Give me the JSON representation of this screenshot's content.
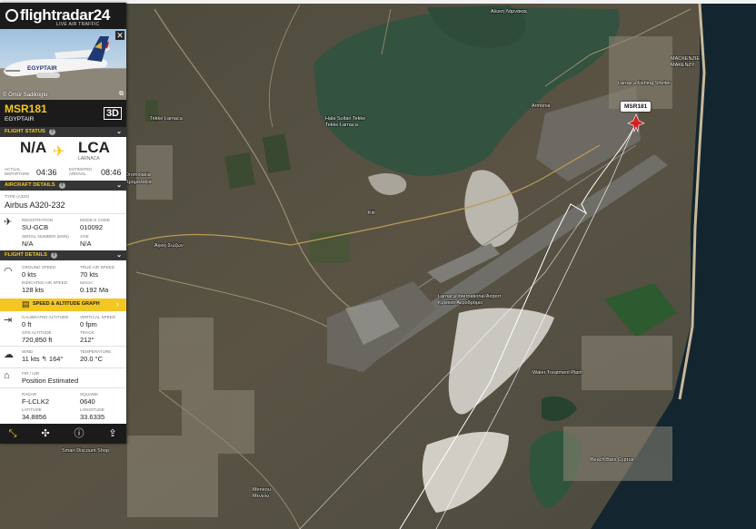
{
  "app": {
    "logo": "flightradar24",
    "tagline": "LIVE AIR TRAFFIC"
  },
  "photo": {
    "credit": "© Ömür Sadikoglu",
    "livery": "EGYPTAIR"
  },
  "flight": {
    "callsign": "MSR181",
    "airline": "EGYPTAIR",
    "view3d": "3D"
  },
  "sections": {
    "status": "FLIGHT STATUS",
    "aircraft": "AIRCRAFT DETAILS",
    "details": "FLIGHT DETAILS"
  },
  "route": {
    "origin": "N/A",
    "destination": "LCA",
    "destination_city": "LARNACA",
    "actual_departure_label": "ACTUAL\nDEPARTURE",
    "actual_departure": "04:36",
    "estimated_arrival_label": "ESTIMATED\nARRIVAL",
    "estimated_arrival": "08:46"
  },
  "aircraft": {
    "type_label": "TYPE",
    "type_code": "(A320)",
    "type": "Airbus A320-232",
    "registration_label": "REGISTRATION",
    "registration": "SU-GCB",
    "modes_label": "MODE-S CODE",
    "modes": "010092",
    "serial_label": "SERIAL NUMBER (MSN)",
    "serial": "N/A",
    "age_label": "AGE",
    "age": "N/A"
  },
  "details": {
    "ground_speed_label": "GROUND SPEED",
    "ground_speed": "0 kts",
    "true_air_speed_label": "TRUE AIR SPEED",
    "true_air_speed": "70 kts",
    "ias_label": "INDICATED AIR SPEED",
    "ias": "128 kts",
    "mach_label": "MACH",
    "mach": "0.192 Ma",
    "graph_button": "SPEED & ALTITUDE GRAPH",
    "cal_alt_label": "CALIBRATED ALTITUDE",
    "cal_alt": "0 ft",
    "vspeed_label": "VERTICAL SPEED",
    "vspeed": "0 fpm",
    "gps_alt_label": "GPS ALTITUDE",
    "gps_alt": "720,850 ft",
    "track_label": "TRACK",
    "track": "212°",
    "wind_label": "WIND",
    "wind": "11 kts  ↰  164°",
    "temp_label": "TEMPERATURE",
    "temp": "20.0 °C",
    "fir_label": "FIR / UIR",
    "fir": "Position Estimated",
    "radar_label": "RADAR",
    "radar": "F-LCLK2",
    "squawk_label": "SQUAWK",
    "squawk": "0640",
    "lat_label": "LATITUDE",
    "lat": "34.8856",
    "lon_label": "LONGITUDE",
    "lon": "33.6335"
  },
  "map": {
    "flight_label": "MSR181",
    "places": [
      "Αλυκή Λάρνακας",
      "Hala Sultan Tekke",
      "Tekke Larnaca",
      "Dromolaxia",
      "Δρομολαξιά",
      "Kiti",
      "Meneou",
      "Μενεού",
      "Armonia",
      "MACKENZIE",
      "ΜΑΚΕΝΖΥ",
      "Larnaca International Airport",
      "Κρατικό Αεροδρόμιο",
      "Water Treatment Plant",
      "Beach Bars Cyprus",
      "Smart Discount Shop",
      "Tekke Larnaca",
      "Larnaca Fishing Shelter",
      "Άγιος Σώζων"
    ]
  },
  "toolbar": {
    "icons": [
      "route-icon",
      "expand-icon",
      "alert-icon",
      "share-icon"
    ]
  },
  "colors": {
    "accent": "#f3c622",
    "panel_dark": "#1b1b1b",
    "section": "#353535"
  }
}
